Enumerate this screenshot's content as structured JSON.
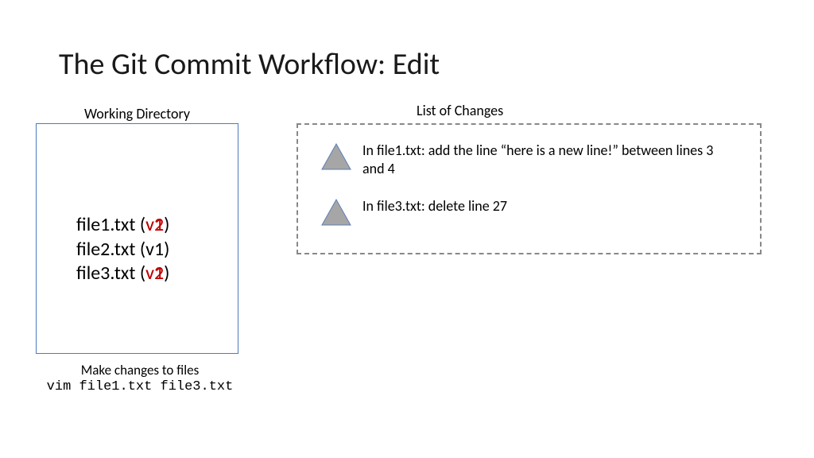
{
  "title": "The Git Commit Workflow: Edit",
  "workingDirectory": {
    "label": "Working Directory",
    "files": [
      {
        "name": "file1.txt",
        "versionDisplay": "v2",
        "versionBehind": "v1",
        "highlighted": true
      },
      {
        "name": "file2.txt",
        "versionDisplay": "v1",
        "versionBehind": "",
        "highlighted": false
      },
      {
        "name": "file3.txt",
        "versionDisplay": "v2",
        "versionBehind": "v1",
        "highlighted": true
      }
    ],
    "caption": "Make changes to files",
    "command": "vim file1.txt file3.txt"
  },
  "changes": {
    "label": "List of Changes",
    "items": [
      "In file1.txt: add the line “here is a new line!” between lines 3 and 4",
      "In file3.txt: delete line 27"
    ]
  },
  "icons": {
    "triangle": "triangle-icon"
  }
}
